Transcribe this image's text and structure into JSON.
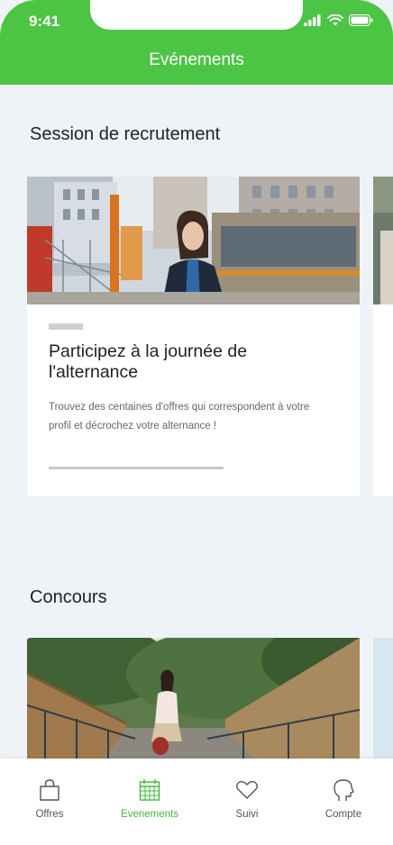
{
  "status_bar": {
    "time": "9:41"
  },
  "header": {
    "title": "Evénements"
  },
  "sections": [
    {
      "title": "Session de recrutement",
      "card": {
        "title": "Participez à la journée de l'alternance",
        "description": "Trouvez des centaines d'offres qui correspondent à votre profil et décrochez votre alternance !"
      }
    },
    {
      "title": "Concours"
    }
  ],
  "bottom_nav": {
    "items": [
      {
        "label": "Offres",
        "icon": "shopping-bag-icon"
      },
      {
        "label": "Evenements",
        "icon": "calendar-icon",
        "active": true
      },
      {
        "label": "Suivi",
        "icon": "heart-icon"
      },
      {
        "label": "Compte",
        "icon": "user-head-icon"
      }
    ]
  },
  "colors": {
    "brand_green": "#4cc444",
    "active_green": "#43b83a",
    "background": "#eef3f7"
  }
}
